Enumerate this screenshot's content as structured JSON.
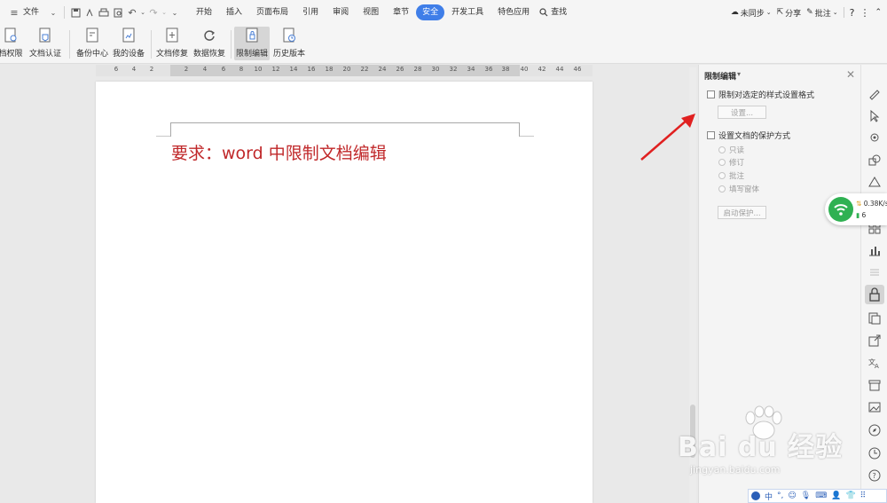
{
  "menubar": {
    "file_label": "文件",
    "tabs": [
      {
        "label": "开始"
      },
      {
        "label": "插入"
      },
      {
        "label": "页面布局"
      },
      {
        "label": "引用"
      },
      {
        "label": "审阅"
      },
      {
        "label": "视图"
      },
      {
        "label": "章节"
      },
      {
        "label": "安全"
      },
      {
        "label": "开发工具"
      },
      {
        "label": "特色应用"
      }
    ],
    "active_tab": "安全",
    "search_label": "查找",
    "sync_label": "未同步",
    "share_label": "分享",
    "comment_label": "批注",
    "help_label": "?"
  },
  "ribbon": {
    "buttons": [
      {
        "label": "档权限",
        "icon": "document-permission-icon"
      },
      {
        "label": "文档认证",
        "icon": "document-certify-icon"
      },
      {
        "label": "备份中心",
        "icon": "backup-center-icon"
      },
      {
        "label": "我的设备",
        "icon": "my-device-icon"
      },
      {
        "label": "文档修复",
        "icon": "document-repair-icon"
      },
      {
        "label": "数据恢复",
        "icon": "data-recovery-icon"
      },
      {
        "label": "限制编辑",
        "icon": "restrict-editing-icon"
      },
      {
        "label": "历史版本",
        "icon": "history-version-icon"
      }
    ]
  },
  "ruler": {
    "ticks": [
      "6",
      "4",
      "2",
      "2",
      "4",
      "6",
      "8",
      "10",
      "12",
      "14",
      "16",
      "18",
      "20",
      "22",
      "24",
      "26",
      "28",
      "30",
      "32",
      "34",
      "36",
      "38",
      "40",
      "42",
      "44",
      "46"
    ]
  },
  "document": {
    "title": "要求：word 中限制文档编辑"
  },
  "pane": {
    "title": "限制编辑",
    "option1_label": "限制对选定的样式设置格式",
    "settings_button": "设置...",
    "option2_label": "设置文档的保护方式",
    "radios": [
      "只读",
      "修订",
      "批注",
      "填写窗体"
    ],
    "start_button": "启动保护..."
  },
  "network": {
    "speed": "0.38K/s",
    "count": "6"
  },
  "ime": {
    "lang": "中"
  },
  "watermark": {
    "brand": "Bai du 经验",
    "url": "jingyan.baidu.com"
  },
  "colors": {
    "accent": "#3f7ee8",
    "title_red": "#c0282a",
    "arrow_red": "#e02020",
    "wifi_green": "#2fb152"
  }
}
